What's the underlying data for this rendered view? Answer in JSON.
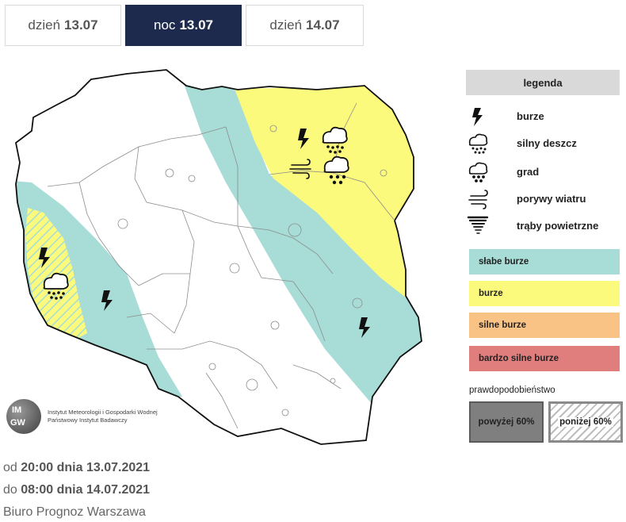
{
  "tabs": [
    {
      "prefix": "dzień",
      "date": "13.07",
      "active": false
    },
    {
      "prefix": "noc",
      "date": "13.07",
      "active": true
    },
    {
      "prefix": "dzień",
      "date": "14.07",
      "active": false
    }
  ],
  "map": {
    "zone_colors": {
      "weak": "#a7ddd6",
      "storm": "#fbfa7c",
      "strong": "#fac386",
      "very_strong": "#e07d7d"
    },
    "icons": [
      "lightning-bolt-icon",
      "lightning-bolt-icon",
      "lightning-bolt-icon",
      "lightning-bolt-icon",
      "heavy-rain-icon",
      "heavy-rain-icon",
      "hail-icon",
      "wind-gust-icon"
    ]
  },
  "logo": {
    "abbr_line1": "IM",
    "abbr_line2": "GW",
    "caption_line1": "Instytut Meteorologii i Gospodarki Wodnej",
    "caption_line2": "Państwowy Instytut Badawczy"
  },
  "legend": {
    "title": "legenda",
    "items": [
      {
        "icon": "lightning-bolt-icon",
        "label": "burze"
      },
      {
        "icon": "heavy-rain-icon",
        "label": "silny deszcz"
      },
      {
        "icon": "hail-icon",
        "label": "grad"
      },
      {
        "icon": "wind-gust-icon",
        "label": "porywy wiatru"
      },
      {
        "icon": "tornado-icon",
        "label": "trąby powietrzne"
      }
    ],
    "levels": [
      {
        "label": "słabe burze",
        "color": "#a7ddd6"
      },
      {
        "label": "burze",
        "color": "#fbfa7c"
      },
      {
        "label": "silne burze",
        "color": "#fac386"
      },
      {
        "label": "bardzo silne burze",
        "color": "#e07d7d"
      }
    ],
    "probability_title": "prawdopodobieństwo",
    "above": "powyżej 60%",
    "below": "poniżej 60%"
  },
  "footer": {
    "from_prefix": "od",
    "from_value": "20:00 dnia 13.07.2021",
    "to_prefix": "do",
    "to_value": "08:00 dnia 14.07.2021",
    "office": "Biuro Prognoz Warszawa"
  }
}
